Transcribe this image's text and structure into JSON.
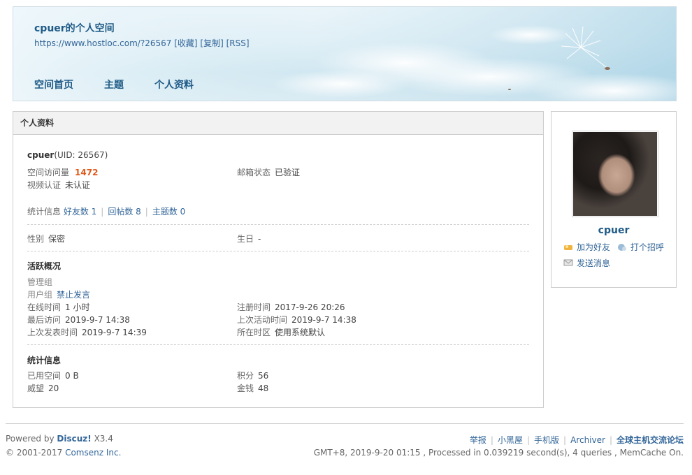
{
  "header": {
    "title": "cpuer的个人空间",
    "url": "https://www.hostloc.com/?26567",
    "favorite_label": "[收藏]",
    "copy_label": "[复制]",
    "rss_label": "[RSS]",
    "nav": [
      "空间首页",
      "主题",
      "个人资料"
    ]
  },
  "panel": {
    "title": "个人资料",
    "username": "cpuer",
    "uid_text": "(UID: 26567)",
    "visits_label": "空间访问量",
    "visits_value": "1472",
    "email_label": "邮箱状态",
    "email_value": "已验证",
    "video_label": "视频认证",
    "video_value": "未认证",
    "stats_label": "统计信息",
    "friends_link": "好友数 1",
    "replies_link": "回帖数 8",
    "threads_link": "主题数 0",
    "gender_label": "性别",
    "gender_value": "保密",
    "birthday_label": "生日",
    "birthday_value": "-",
    "activity_title": "活跃概况",
    "admin_group_label": "管理组",
    "user_group_label": "用户组",
    "user_group_value": "禁止发言",
    "online_label": "在线时间",
    "online_value": "1 小时",
    "register_label": "注册时间",
    "register_value": "2017-9-26 20:26",
    "last_visit_label": "最后访问",
    "last_visit_value": "2019-9-7 14:38",
    "last_active_label": "上次活动时间",
    "last_active_value": "2019-9-7 14:38",
    "last_post_label": "上次发表时间",
    "last_post_value": "2019-9-7 14:39",
    "timezone_label": "所在时区",
    "timezone_value": "使用系统默认",
    "stats_title": "统计信息",
    "space_label": "已用空间",
    "space_value": "0 B",
    "credits_label": "积分",
    "credits_value": "56",
    "prestige_label": "威望",
    "prestige_value": "20",
    "money_label": "金钱",
    "money_value": "48"
  },
  "sidebar": {
    "name": "cpuer",
    "add_friend": "加为好友",
    "greet": "打个招呼",
    "send_message": "发送消息"
  },
  "footer": {
    "powered_prefix": "Powered by",
    "powered_brand": "Discuz!",
    "powered_version": "X3.4",
    "copyright_prefix": "© 2001-2017",
    "copyright_company": "Comsenz Inc.",
    "links": [
      "举报",
      "小黑屋",
      "手机版",
      "Archiver",
      "全球主机交流论坛"
    ],
    "stats": "GMT+8, 2019-9-20 01:15 , Processed in 0.039219 second(s), 4 queries , MemCache On."
  },
  "colors": {
    "link": "#336699",
    "highlight": "#e0581b",
    "panel_head_bg": "#f2f2f2"
  }
}
